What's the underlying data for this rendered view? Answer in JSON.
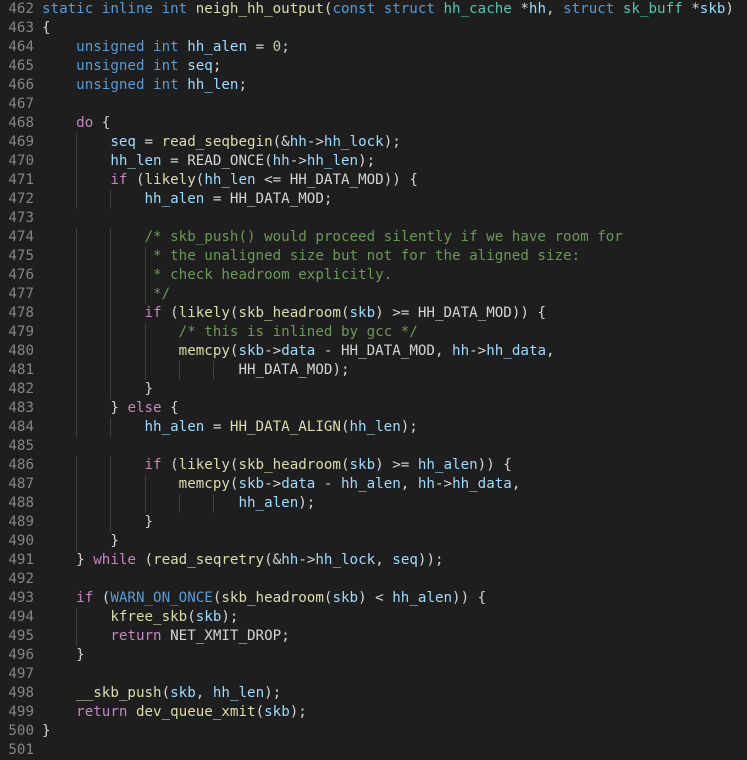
{
  "editor": {
    "lines": [
      {
        "n": "462",
        "t": [
          [
            "kw",
            "static "
          ],
          [
            "kw",
            "inline "
          ],
          [
            "kw",
            "int "
          ],
          [
            "fn",
            "neigh_hh_output"
          ],
          [
            "pl",
            "("
          ],
          [
            "kw",
            "const "
          ],
          [
            "kw",
            "struct "
          ],
          [
            "ty",
            "hh_cache "
          ],
          [
            "pl",
            "*"
          ],
          [
            "var",
            "hh"
          ],
          [
            "pl",
            ", "
          ],
          [
            "kw",
            "struct "
          ],
          [
            "ty",
            "sk_buff "
          ],
          [
            "pl",
            "*"
          ],
          [
            "var",
            "skb"
          ],
          [
            "pl",
            ")"
          ]
        ]
      },
      {
        "n": "463",
        "t": [
          [
            "pl",
            "{"
          ]
        ]
      },
      {
        "n": "464",
        "t": [
          [
            "pl",
            "    "
          ],
          [
            "kw",
            "unsigned "
          ],
          [
            "kw",
            "int "
          ],
          [
            "var",
            "hh_alen"
          ],
          [
            "pl",
            " = "
          ],
          [
            "num",
            "0"
          ],
          [
            "pl",
            ";"
          ]
        ]
      },
      {
        "n": "465",
        "t": [
          [
            "pl",
            "    "
          ],
          [
            "kw",
            "unsigned "
          ],
          [
            "kw",
            "int "
          ],
          [
            "var",
            "seq"
          ],
          [
            "pl",
            ";"
          ]
        ]
      },
      {
        "n": "466",
        "t": [
          [
            "pl",
            "    "
          ],
          [
            "kw",
            "unsigned "
          ],
          [
            "kw",
            "int "
          ],
          [
            "var",
            "hh_len"
          ],
          [
            "pl",
            ";"
          ]
        ]
      },
      {
        "n": "467",
        "t": []
      },
      {
        "n": "468",
        "t": [
          [
            "pl",
            "    "
          ],
          [
            "ctl",
            "do "
          ],
          [
            "pl",
            "{"
          ]
        ]
      },
      {
        "n": "469",
        "t": [
          [
            "pl",
            "        "
          ],
          [
            "var",
            "seq"
          ],
          [
            "pl",
            " = "
          ],
          [
            "fn",
            "read_seqbegin"
          ],
          [
            "pl",
            "(&"
          ],
          [
            "var",
            "hh"
          ],
          [
            "pl",
            "->"
          ],
          [
            "var",
            "hh_lock"
          ],
          [
            "pl",
            ");"
          ]
        ]
      },
      {
        "n": "470",
        "t": [
          [
            "pl",
            "        "
          ],
          [
            "var",
            "hh_len"
          ],
          [
            "pl",
            " = "
          ],
          [
            "pl",
            "READ_ONCE"
          ],
          [
            "pl",
            "("
          ],
          [
            "var",
            "hh"
          ],
          [
            "pl",
            "->"
          ],
          [
            "var",
            "hh_len"
          ],
          [
            "pl",
            ");"
          ]
        ]
      },
      {
        "n": "471",
        "t": [
          [
            "pl",
            "        "
          ],
          [
            "ctl",
            "if "
          ],
          [
            "pl",
            "("
          ],
          [
            "fn",
            "likely"
          ],
          [
            "pl",
            "("
          ],
          [
            "var",
            "hh_len"
          ],
          [
            "pl",
            " <= "
          ],
          [
            "pl",
            "HH_DATA_MOD"
          ],
          [
            "pl",
            ")) {"
          ]
        ]
      },
      {
        "n": "472",
        "t": [
          [
            "pl",
            "            "
          ],
          [
            "var",
            "hh_alen"
          ],
          [
            "pl",
            " = "
          ],
          [
            "pl",
            "HH_DATA_MOD"
          ],
          [
            "pl",
            ";"
          ]
        ]
      },
      {
        "n": "473",
        "t": []
      },
      {
        "n": "474",
        "t": [
          [
            "pl",
            "            "
          ],
          [
            "cm",
            "/* skb_push() would proceed silently if we have room for"
          ]
        ]
      },
      {
        "n": "475",
        "t": [
          [
            "pl",
            "             "
          ],
          [
            "cm",
            "* the unaligned size but not for the aligned size:"
          ]
        ]
      },
      {
        "n": "476",
        "t": [
          [
            "pl",
            "             "
          ],
          [
            "cm",
            "* check headroom explicitly."
          ]
        ]
      },
      {
        "n": "477",
        "t": [
          [
            "pl",
            "             "
          ],
          [
            "cm",
            "*/"
          ]
        ]
      },
      {
        "n": "478",
        "t": [
          [
            "pl",
            "            "
          ],
          [
            "ctl",
            "if "
          ],
          [
            "pl",
            "("
          ],
          [
            "fn",
            "likely"
          ],
          [
            "pl",
            "("
          ],
          [
            "fn",
            "skb_headroom"
          ],
          [
            "pl",
            "("
          ],
          [
            "var",
            "skb"
          ],
          [
            "pl",
            ") >= "
          ],
          [
            "pl",
            "HH_DATA_MOD"
          ],
          [
            "pl",
            ")) {"
          ]
        ]
      },
      {
        "n": "479",
        "t": [
          [
            "pl",
            "                "
          ],
          [
            "cm",
            "/* this is inlined by gcc */"
          ]
        ]
      },
      {
        "n": "480",
        "t": [
          [
            "pl",
            "                "
          ],
          [
            "fn",
            "memcpy"
          ],
          [
            "pl",
            "("
          ],
          [
            "var",
            "skb"
          ],
          [
            "pl",
            "->"
          ],
          [
            "var",
            "data"
          ],
          [
            "pl",
            " - "
          ],
          [
            "pl",
            "HH_DATA_MOD"
          ],
          [
            "pl",
            ", "
          ],
          [
            "var",
            "hh"
          ],
          [
            "pl",
            "->"
          ],
          [
            "var",
            "hh_data"
          ],
          [
            "pl",
            ","
          ]
        ]
      },
      {
        "n": "481",
        "t": [
          [
            "pl",
            "                       "
          ],
          [
            "pl",
            "HH_DATA_MOD"
          ],
          [
            "pl",
            ");"
          ]
        ]
      },
      {
        "n": "482",
        "t": [
          [
            "pl",
            "            "
          ],
          [
            "pl",
            "}"
          ]
        ]
      },
      {
        "n": "483",
        "t": [
          [
            "pl",
            "        "
          ],
          [
            "pl",
            "} "
          ],
          [
            "ctl",
            "else "
          ],
          [
            "pl",
            "{"
          ]
        ]
      },
      {
        "n": "484",
        "t": [
          [
            "pl",
            "            "
          ],
          [
            "var",
            "hh_alen"
          ],
          [
            "pl",
            " = "
          ],
          [
            "fn",
            "HH_DATA_ALIGN"
          ],
          [
            "pl",
            "("
          ],
          [
            "var",
            "hh_len"
          ],
          [
            "pl",
            ");"
          ]
        ]
      },
      {
        "n": "485",
        "t": []
      },
      {
        "n": "486",
        "t": [
          [
            "pl",
            "            "
          ],
          [
            "ctl",
            "if "
          ],
          [
            "pl",
            "("
          ],
          [
            "fn",
            "likely"
          ],
          [
            "pl",
            "("
          ],
          [
            "fn",
            "skb_headroom"
          ],
          [
            "pl",
            "("
          ],
          [
            "var",
            "skb"
          ],
          [
            "pl",
            ") >= "
          ],
          [
            "var",
            "hh_alen"
          ],
          [
            "pl",
            ")) {"
          ]
        ]
      },
      {
        "n": "487",
        "t": [
          [
            "pl",
            "                "
          ],
          [
            "fn",
            "memcpy"
          ],
          [
            "pl",
            "("
          ],
          [
            "var",
            "skb"
          ],
          [
            "pl",
            "->"
          ],
          [
            "var",
            "data"
          ],
          [
            "pl",
            " - "
          ],
          [
            "var",
            "hh_alen"
          ],
          [
            "pl",
            ", "
          ],
          [
            "var",
            "hh"
          ],
          [
            "pl",
            "->"
          ],
          [
            "var",
            "hh_data"
          ],
          [
            "pl",
            ","
          ]
        ]
      },
      {
        "n": "488",
        "t": [
          [
            "pl",
            "                       "
          ],
          [
            "var",
            "hh_alen"
          ],
          [
            "pl",
            ");"
          ]
        ]
      },
      {
        "n": "489",
        "t": [
          [
            "pl",
            "            "
          ],
          [
            "pl",
            "}"
          ]
        ]
      },
      {
        "n": "490",
        "t": [
          [
            "pl",
            "        "
          ],
          [
            "pl",
            "}"
          ]
        ]
      },
      {
        "n": "491",
        "t": [
          [
            "pl",
            "    "
          ],
          [
            "pl",
            "} "
          ],
          [
            "ctl",
            "while "
          ],
          [
            "pl",
            "("
          ],
          [
            "fn",
            "read_seqretry"
          ],
          [
            "pl",
            "(&"
          ],
          [
            "var",
            "hh"
          ],
          [
            "pl",
            "->"
          ],
          [
            "var",
            "hh_lock"
          ],
          [
            "pl",
            ", "
          ],
          [
            "var",
            "seq"
          ],
          [
            "pl",
            "));"
          ]
        ]
      },
      {
        "n": "492",
        "t": []
      },
      {
        "n": "493",
        "t": [
          [
            "pl",
            "    "
          ],
          [
            "ctl",
            "if "
          ],
          [
            "pl",
            "("
          ],
          [
            "mac",
            "WARN_ON_ONCE"
          ],
          [
            "pl",
            "("
          ],
          [
            "fn",
            "skb_headroom"
          ],
          [
            "pl",
            "("
          ],
          [
            "var",
            "skb"
          ],
          [
            "pl",
            ") < "
          ],
          [
            "var",
            "hh_alen"
          ],
          [
            "pl",
            ")) {"
          ]
        ]
      },
      {
        "n": "494",
        "t": [
          [
            "pl",
            "        "
          ],
          [
            "fn",
            "kfree_skb"
          ],
          [
            "pl",
            "("
          ],
          [
            "var",
            "skb"
          ],
          [
            "pl",
            ");"
          ]
        ]
      },
      {
        "n": "495",
        "t": [
          [
            "pl",
            "        "
          ],
          [
            "ctl",
            "return "
          ],
          [
            "pl",
            "NET_XMIT_DROP"
          ],
          [
            "pl",
            ";"
          ]
        ]
      },
      {
        "n": "496",
        "t": [
          [
            "pl",
            "    "
          ],
          [
            "pl",
            "}"
          ]
        ]
      },
      {
        "n": "497",
        "t": []
      },
      {
        "n": "498",
        "t": [
          [
            "pl",
            "    "
          ],
          [
            "fn",
            "__skb_push"
          ],
          [
            "pl",
            "("
          ],
          [
            "var",
            "skb"
          ],
          [
            "pl",
            ", "
          ],
          [
            "var",
            "hh_len"
          ],
          [
            "pl",
            ");"
          ]
        ]
      },
      {
        "n": "499",
        "t": [
          [
            "pl",
            "    "
          ],
          [
            "ctl",
            "return "
          ],
          [
            "fn",
            "dev_queue_xmit"
          ],
          [
            "pl",
            "("
          ],
          [
            "var",
            "skb"
          ],
          [
            "pl",
            ");"
          ]
        ]
      },
      {
        "n": "500",
        "t": [
          [
            "pl",
            "}"
          ]
        ]
      },
      {
        "n": "501",
        "t": []
      }
    ]
  }
}
